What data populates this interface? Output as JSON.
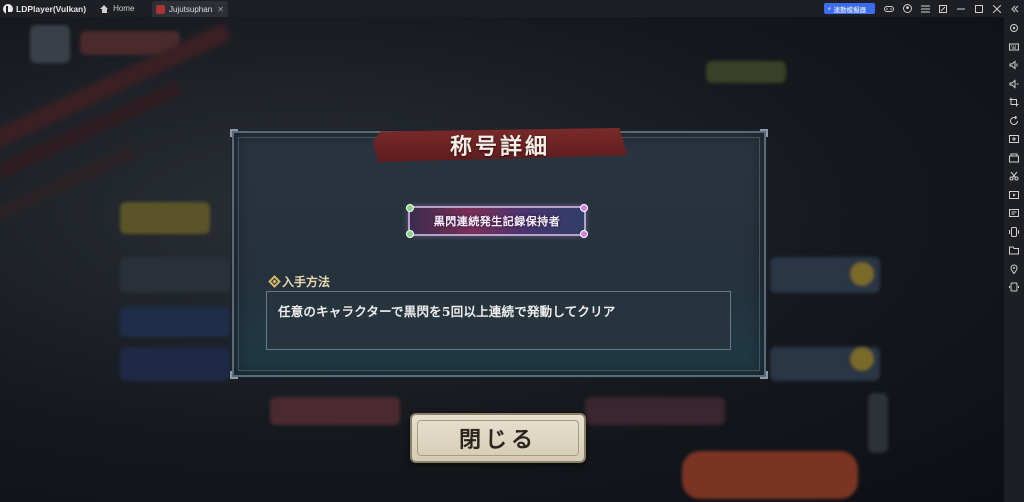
{
  "titlebar": {
    "app_title": "LDPlayer(Vulkan)",
    "home_label": "Home",
    "game_tab_label": "Jujutsuphan...",
    "sync_label": "連動模擬器"
  },
  "dialog": {
    "title": "称号詳細",
    "badge_text": "黒閃連続発生記録保持者",
    "section_label": "入手方法",
    "description": "任意のキャラクターで黒閃を5回以上連続で発動してクリア",
    "close_label": "閉じる"
  }
}
